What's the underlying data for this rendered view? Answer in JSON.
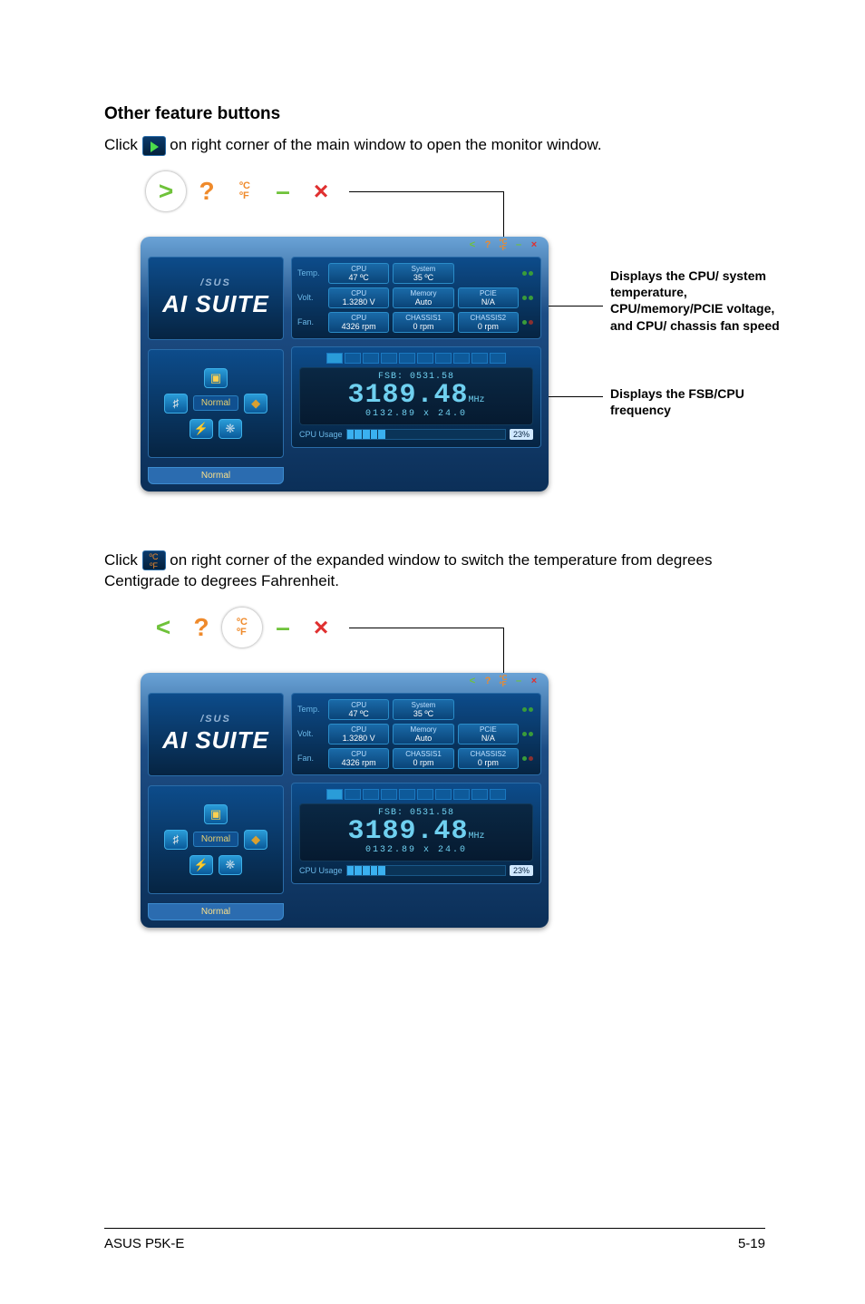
{
  "section1": {
    "heading": "Other feature buttons",
    "para_before": "Click ",
    "para_after": " on right corner of the main window to open the monitor window."
  },
  "section2": {
    "para_before": "Click ",
    "para_after": " on right corner of the expanded window to switch the temperature from degrees Centigrade to degrees Fahrenheit."
  },
  "callouts": {
    "readings": "Displays the CPU/ system temperature, CPU/memory/PCIE voltage, and CPU/ chassis fan speed",
    "freq": "Displays the FSB/CPU frequency"
  },
  "ai": {
    "brand": "/SUS",
    "suite": "AI SUITE",
    "mode_current": "Normal",
    "status": "Normal",
    "readings": {
      "temp_label": "Temp.",
      "volt_label": "Volt.",
      "fan_label": "Fan.",
      "temp": [
        {
          "h": "CPU",
          "v": "47 ºC"
        },
        {
          "h": "System",
          "v": "35 ºC"
        }
      ],
      "volt": [
        {
          "h": "CPU",
          "v": "1.3280 V"
        },
        {
          "h": "Memory",
          "v": "Auto"
        },
        {
          "h": "PCIE",
          "v": "N/A"
        }
      ],
      "fan": [
        {
          "h": "CPU",
          "v": "4326 rpm"
        },
        {
          "h": "CHASSIS1",
          "v": "0 rpm"
        },
        {
          "h": "CHASSIS2",
          "v": "0 rpm"
        }
      ]
    },
    "freq": {
      "fsb_label": "FSB:",
      "fsb": "0531.58",
      "main": "3189.48",
      "unit": "MHz",
      "sub": "0132.89 x 24.0",
      "usage_label": "CPU Usage",
      "usage_pct": "23%"
    }
  },
  "footer": {
    "left": "ASUS P5K-E",
    "right": "5-19"
  }
}
